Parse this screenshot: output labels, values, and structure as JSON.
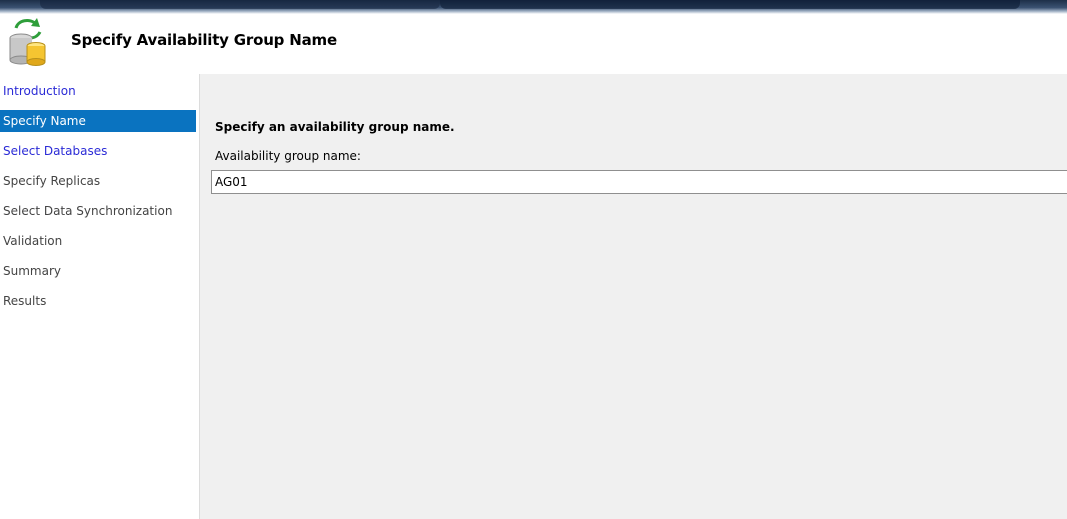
{
  "header": {
    "title": "Specify Availability Group Name",
    "icon": "database-sync-icon"
  },
  "sidebar": {
    "items": [
      {
        "label": "Introduction",
        "state": "link"
      },
      {
        "label": "Specify Name",
        "state": "active"
      },
      {
        "label": "Select Databases",
        "state": "link"
      },
      {
        "label": "Specify Replicas",
        "state": "disabled"
      },
      {
        "label": "Select Data Synchronization",
        "state": "disabled"
      },
      {
        "label": "Validation",
        "state": "disabled"
      },
      {
        "label": "Summary",
        "state": "disabled"
      },
      {
        "label": "Results",
        "state": "disabled"
      }
    ]
  },
  "main": {
    "heading": "Specify an availability group name.",
    "field_label": "Availability group name:",
    "field_value": "AG01"
  },
  "colors": {
    "active_item_bg": "#0a73c0",
    "link_text": "#2b2bd6",
    "disabled_text": "#444444",
    "content_bg": "#f0f0f0"
  }
}
